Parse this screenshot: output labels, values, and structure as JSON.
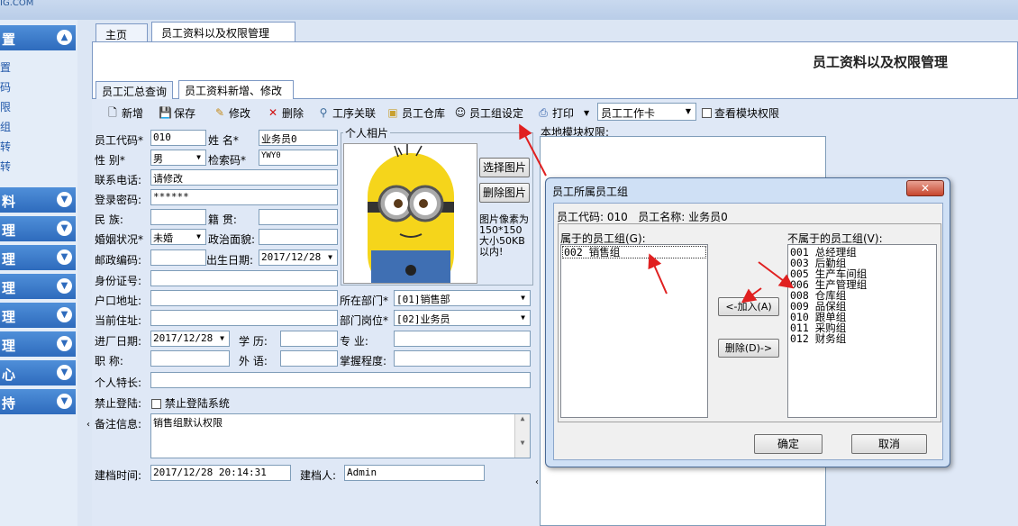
{
  "brand_fragment": "IG.COM",
  "sidebar": {
    "sections": [
      {
        "label": "置",
        "chevron": "⌃"
      },
      {
        "label": "料",
        "chevron": "⌄"
      },
      {
        "label": "理",
        "chevron": "⌄"
      },
      {
        "label": "理",
        "chevron": "⌄"
      },
      {
        "label": "理",
        "chevron": "⌄"
      },
      {
        "label": "理",
        "chevron": "⌄"
      },
      {
        "label": "理",
        "chevron": "⌄"
      },
      {
        "label": "心",
        "chevron": "⌄"
      },
      {
        "label": "持",
        "chevron": "⌄"
      }
    ],
    "sub_items": [
      "置",
      "码",
      "限",
      "组",
      "转",
      "转"
    ]
  },
  "tabs": [
    {
      "label": "主页"
    },
    {
      "label": "员工资料以及权限管理",
      "close": "×"
    }
  ],
  "module_title": "员工资料以及权限管理",
  "subtabs": [
    "员工汇总查询",
    "员工资料新增、修改"
  ],
  "toolbar": {
    "new": "新增",
    "save": "保存",
    "edit": "修改",
    "delete": "删除",
    "process": "工序关联",
    "warehouse": "员工仓库",
    "group": "员工组设定",
    "print": "打印",
    "print_combo": "员工工作卡",
    "view_perm": "查看模块权限"
  },
  "form": {
    "emp_code_label": "员工代码*",
    "emp_code": "010",
    "name_label": "姓  名*",
    "name": "业务员0",
    "gender_label": "性  别*",
    "gender": "男",
    "search_label": "检索码*",
    "search_code": "YWY0",
    "phone_label": "联系电话:",
    "phone": "请修改",
    "password_label": "登录密码:",
    "password": "******",
    "ethnic_label": "民  族:",
    "native_label": "籍  贯:",
    "marital_label": "婚姻状况*",
    "marital": "未婚",
    "political_label": "政治面貌:",
    "postal_label": "邮政编码:",
    "birth_label": "出生日期:",
    "birth": "2017/12/28",
    "id_label": "身份证号:",
    "residence_label": "户口地址:",
    "dept_label": "所在部门*",
    "dept": "[01]销售部",
    "address_label": "当前住址:",
    "post_label": "部门岗位*",
    "post": "[02]业务员",
    "entry_label": "进厂日期:",
    "entry": "2017/12/28",
    "edu_label": "学  历:",
    "major_label": "专  业:",
    "title_label": "职  称:",
    "lang_label": "外  语:",
    "mastery_label": "掌握程度:",
    "skill_label": "个人特长:",
    "forbid_label": "禁止登陆:",
    "forbid_check": "禁止登陆系统",
    "remark_label": "备注信息:",
    "remark": "销售组默认权限",
    "created_label": "建档时间:",
    "created": "2017/12/28 20:14:31",
    "creator_label": "建档人:",
    "creator": "Admin"
  },
  "photo": {
    "group_label": "个人相片",
    "choose": "选择图片",
    "delete": "删除图片",
    "note": "图片像素为150*150大小50KB以内!"
  },
  "local_perm_label": "本地模块权限:",
  "dialog": {
    "title": "员工所属员工组",
    "close": "✕",
    "info_code_label": "员工代码:",
    "info_code": "010",
    "info_name_label": "员工名称:",
    "info_name": "业务员0",
    "belong_label": "属于的员工组(G):",
    "belong_items": [
      "002  销售组"
    ],
    "not_belong_label": "不属于的员工组(V):",
    "not_belong_items": [
      "001  总经理组",
      "003  后勤组",
      "005  生产车间组",
      "006  生产管理组",
      "008  仓库组",
      "009  品保组",
      "010  跟单组",
      "011  采购组",
      "012  财务组"
    ],
    "add_button": "<-加入(A)",
    "remove_button": "删除(D)->",
    "ok_button": "确定",
    "cancel_button": "取消"
  },
  "colors": {
    "accent": "#2e6bbd",
    "annotation_arrow": "#e02020"
  }
}
